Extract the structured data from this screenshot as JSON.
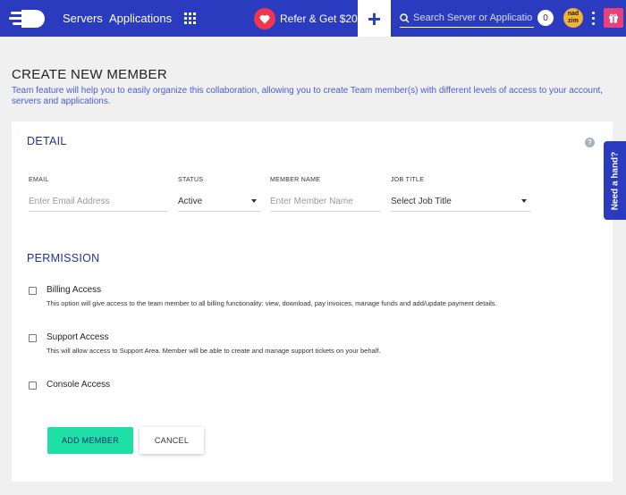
{
  "nav": {
    "servers": "Servers",
    "applications": "Applications",
    "refer_label": "Refer & Get $20",
    "add_label": "+",
    "search_placeholder": "Search Server or Application",
    "notification_count": "0",
    "avatar_line1": "nad",
    "avatar_line2": "zim"
  },
  "page": {
    "title": "CREATE NEW MEMBER",
    "description": "Team feature will help you to easily organize this collaboration, allowing you to create Team member(s) with different levels of access to your account, servers and applications."
  },
  "detail": {
    "title": "DETAIL",
    "help": "?",
    "email": {
      "label": "EMAIL",
      "placeholder": "Enter Email Address"
    },
    "status": {
      "label": "STATUS",
      "value": "Active"
    },
    "member_name": {
      "label": "MEMBER NAME",
      "placeholder": "Enter Member Name"
    },
    "job_title": {
      "label": "JOB TITLE",
      "value": "Select Job Title"
    }
  },
  "permission": {
    "title": "PERMISSION",
    "items": [
      {
        "label": "Billing Access",
        "description": "This option will give access to the team member to all billing functionality: view, download, pay invoices, manage funds and add/update payment details."
      },
      {
        "label": "Support Access",
        "description": "This will allow access to Support Area. Member will be able to create and manage support tickets on your behalf."
      },
      {
        "label": "Console Access",
        "description": ""
      }
    ]
  },
  "actions": {
    "add": "ADD MEMBER",
    "cancel": "CANCEL"
  },
  "side_tab": "Need a hand?",
  "colors": {
    "brand_blue": "#2a3bc0",
    "accent_green": "#1ee0a6",
    "heart_red": "#f0364f",
    "gift_pink": "#e8407a",
    "avatar_yellow": "#f2b233"
  },
  "icons": [
    "logo-icon",
    "apps-grid-icon",
    "heart-icon",
    "plus-icon",
    "search-icon",
    "more-vertical-icon",
    "gift-icon",
    "help-icon",
    "chevron-down-icon"
  ]
}
